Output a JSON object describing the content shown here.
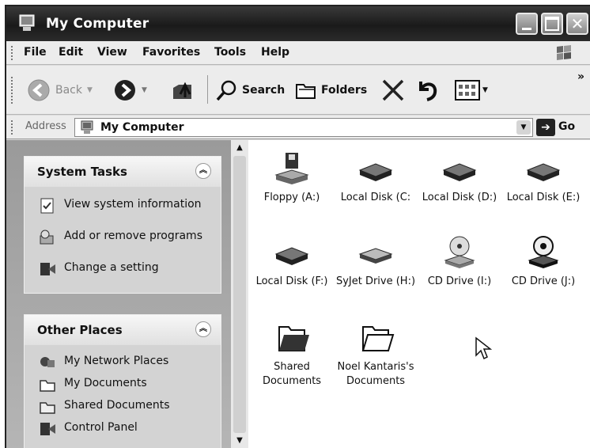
{
  "window": {
    "title": "My Computer"
  },
  "menu": [
    "File",
    "Edit",
    "View",
    "Favorites",
    "Tools",
    "Help"
  ],
  "toolbar": {
    "back_label": "Back",
    "search_label": "Search",
    "folders_label": "Folders",
    "overflow": "»"
  },
  "address": {
    "label": "Address",
    "value": "My Computer",
    "go": "Go"
  },
  "system_tasks": {
    "title": "System Tasks",
    "items": [
      "View system information",
      "Add or remove programs",
      "Change a setting"
    ]
  },
  "other_places": {
    "title": "Other Places",
    "items": [
      "My Network Places",
      "My Documents",
      "Shared Documents",
      "Control Panel"
    ]
  },
  "drives": [
    {
      "label": "Floppy (A:)",
      "icon": "floppy-drive-icon"
    },
    {
      "label": "Local Disk (C:",
      "icon": "hard-disk-icon"
    },
    {
      "label": "Local Disk (D:)",
      "icon": "hard-disk-icon"
    },
    {
      "label": "Local Disk (E:)",
      "icon": "hard-disk-icon"
    },
    {
      "label": "Local Disk (F:)",
      "icon": "hard-disk-icon"
    },
    {
      "label": "SyJet Drive (H:)",
      "icon": "removable-drive-icon"
    },
    {
      "label": "CD Drive (I:)",
      "icon": "cd-drive-icon"
    },
    {
      "label": "CD Drive (J:)",
      "icon": "cd-drive-icon"
    },
    {
      "label": "Shared Documents",
      "icon": "folder-icon"
    },
    {
      "label": "Noel Kantaris's Documents",
      "icon": "folder-icon"
    }
  ]
}
